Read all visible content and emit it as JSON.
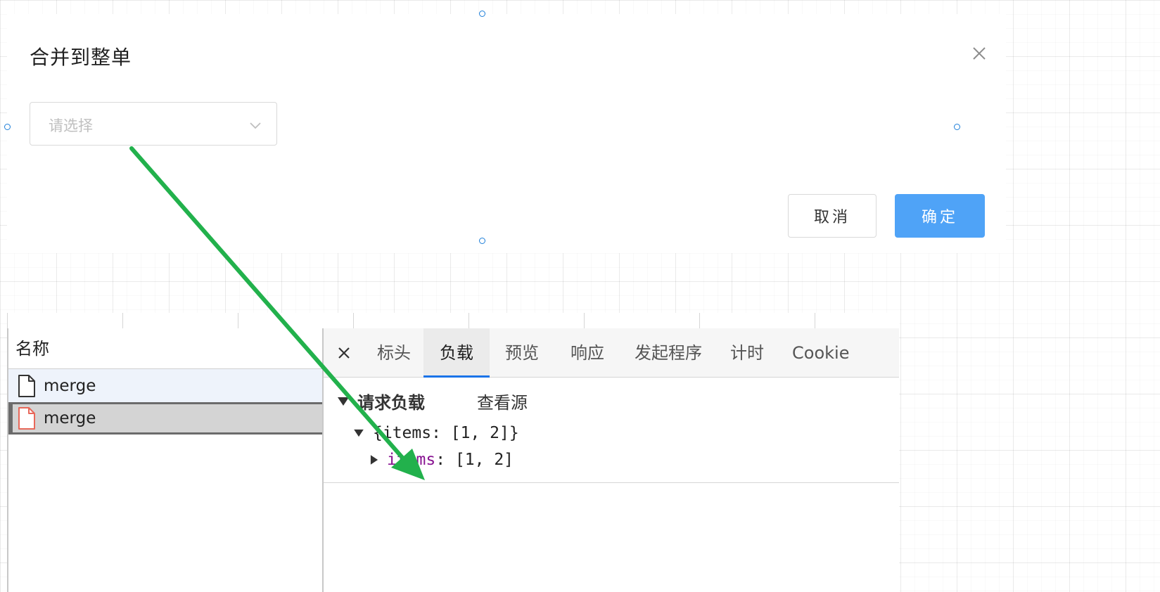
{
  "dialog": {
    "title": "合并到整单",
    "select_placeholder": "请选择",
    "cancel_label": "取消",
    "ok_label": "确定"
  },
  "devtools": {
    "name_header": "名称",
    "requests": [
      {
        "name": "merge",
        "icon": "document-icon"
      },
      {
        "name": "merge",
        "icon": "document-icon-error"
      }
    ],
    "tabs": [
      {
        "label": "标头"
      },
      {
        "label": "负载"
      },
      {
        "label": "预览"
      },
      {
        "label": "响应"
      },
      {
        "label": "发起程序"
      },
      {
        "label": "计时"
      },
      {
        "label": "Cookie"
      }
    ],
    "active_tab": "负载",
    "section_title": "请求负载",
    "view_source_label": "查看源",
    "payload_summary": "{items: [1, 2]}",
    "payload_key": "items",
    "payload_value": ": [1, 2]"
  },
  "colors": {
    "primary": "#4fa3f7",
    "active_tab_underline": "#1a73e8",
    "key_color": "#881391",
    "error_icon": "#e8685a",
    "annotation_arrow": "#22b14c"
  }
}
